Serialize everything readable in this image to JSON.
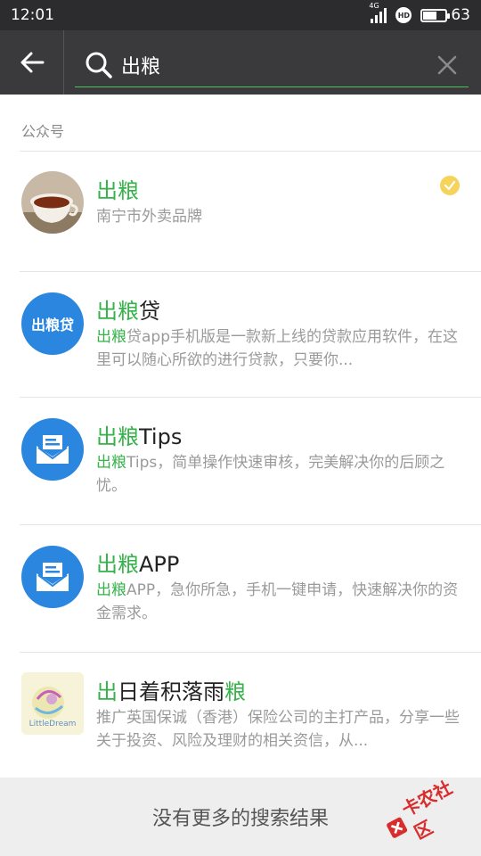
{
  "status_bar": {
    "time": "12:01",
    "network": "4G",
    "battery_level": "63",
    "battery_fraction": 0.63
  },
  "search": {
    "query": "出粮"
  },
  "section": {
    "title": "公众号"
  },
  "results": [
    {
      "name_highlight": "出粮",
      "name_rest": "",
      "desc_highlight": "",
      "desc_rest": "南宁市外卖品牌",
      "verified": true
    },
    {
      "name_highlight": "出粮",
      "name_rest": "贷",
      "avatar_text": "出粮贷",
      "desc_highlight": "出粮",
      "desc_rest": "贷app手机版是一款新上线的贷款应用软件，在这里可以随心所欲的进行贷款，只要你..."
    },
    {
      "name_highlight": "出粮",
      "name_rest": "Tips",
      "desc_highlight": "出粮",
      "desc_rest": "Tips，简单操作快速审核，完美解决你的后顾之忧。"
    },
    {
      "name_highlight": "出粮",
      "name_rest": "APP",
      "desc_highlight": "出粮",
      "desc_rest": "APP，急你所急，手机一键申请，快速解决你的资金需求。"
    },
    {
      "name_part1": "出",
      "name_part2": "日着积落雨",
      "name_part3": "粮",
      "avatar_text": "LittleDream",
      "desc_highlight": "",
      "desc_rest": "推广英国保诚（香港）保险公司的主打产品，分享一些关于投资、风险及理财的相关资信，从..."
    }
  ],
  "footer": {
    "text": "没有更多的搜索结果"
  },
  "watermark": {
    "text": "卡农社区"
  },
  "colors": {
    "accent": "#35b24a",
    "header_bg": "#3a3a3c",
    "status_bg": "#2c2c2e",
    "icon_blue": "#2b86e0"
  }
}
